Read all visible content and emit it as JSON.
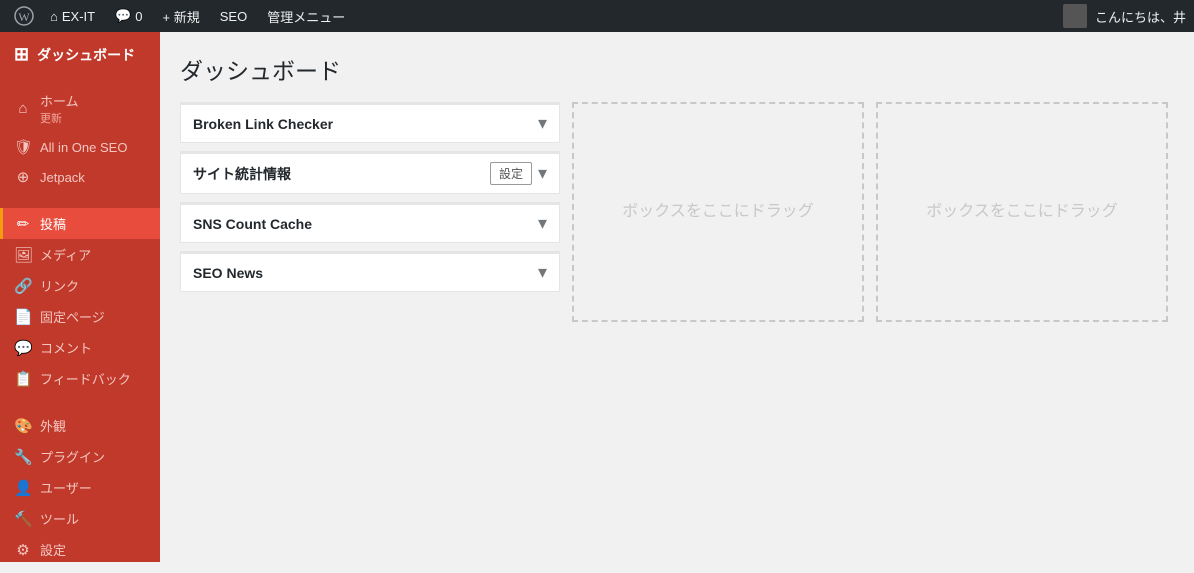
{
  "adminbar": {
    "site_name": "EX-IT",
    "new_label": "+ 新規",
    "seo_label": "SEO",
    "admin_menu_label": "管理メニュー",
    "comment_count": "0",
    "greeting": "こんにちは、井"
  },
  "sidebar": {
    "header_label": "ダッシュボード",
    "groups": [
      {
        "items": [
          {
            "id": "home",
            "label": "ホーム",
            "icon": "⌂",
            "sub": "更新"
          },
          {
            "id": "aioseo",
            "label": "All in One SEO",
            "icon": "🛡"
          },
          {
            "id": "jetpack",
            "label": "Jetpack",
            "icon": "⊕"
          }
        ]
      },
      {
        "items": [
          {
            "id": "posts",
            "label": "投稿",
            "icon": "✏",
            "active": true
          },
          {
            "id": "media",
            "label": "メディア",
            "icon": "🖼"
          },
          {
            "id": "links",
            "label": "リンク",
            "icon": "🔗"
          },
          {
            "id": "pages",
            "label": "固定ページ",
            "icon": "📄"
          },
          {
            "id": "comments",
            "label": "コメント",
            "icon": "💬"
          },
          {
            "id": "feedback",
            "label": "フィードバック",
            "icon": "📋"
          }
        ]
      },
      {
        "items": [
          {
            "id": "appearance",
            "label": "外観",
            "icon": "🎨"
          },
          {
            "id": "plugins",
            "label": "プラグイン",
            "icon": "🔧"
          },
          {
            "id": "users",
            "label": "ユーザー",
            "icon": "👤"
          },
          {
            "id": "tools",
            "label": "ツール",
            "icon": "🔨"
          },
          {
            "id": "settings",
            "label": "設定",
            "icon": "⚙"
          }
        ]
      }
    ]
  },
  "main": {
    "title": "ダッシュボード",
    "widgets": [
      {
        "id": "broken-link-checker",
        "title": "Broken Link Checker",
        "has_settings": false
      },
      {
        "id": "site-stats",
        "title": "サイト統計情報",
        "has_settings": true,
        "settings_label": "設定"
      },
      {
        "id": "sns-count-cache",
        "title": "SNS Count Cache",
        "has_settings": false
      },
      {
        "id": "seo-news",
        "title": "SEO News",
        "has_settings": false
      }
    ],
    "drop_zone_text": "ボックスをここにドラッグ",
    "drop_zone2_text": "ボックスをここにドラッグ"
  },
  "colors": {
    "admin_bar_bg": "#23282d",
    "sidebar_bg": "#c0392b",
    "sidebar_active": "#e74c3c",
    "accent": "#f39c12"
  }
}
